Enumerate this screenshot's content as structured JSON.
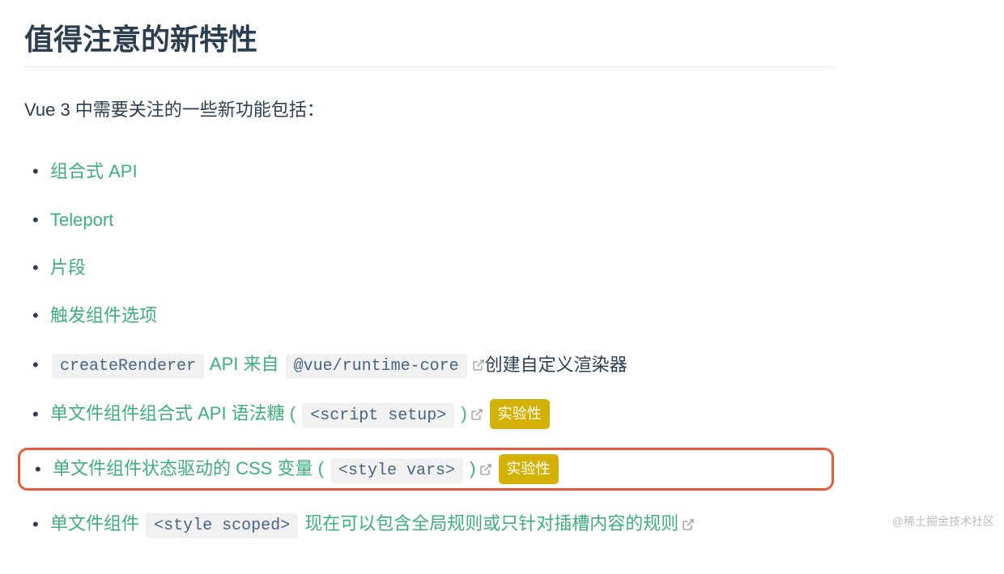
{
  "heading": "值得注意的新特性",
  "intro": "Vue 3 中需要关注的一些新功能包括：",
  "items": {
    "item0": {
      "label": "组合式 API"
    },
    "item1": {
      "label": "Teleport"
    },
    "item2": {
      "label": "片段"
    },
    "item3": {
      "label": "触发组件选项"
    },
    "item4": {
      "code1": "createRenderer",
      "linkText": " API 来自 ",
      "code2": "@vue/runtime-core",
      "tail": " 创建自定义渲染器"
    },
    "item5": {
      "prefix": "单文件组件组合式 API 语法糖 ( ",
      "code": "<script setup>",
      "suffix": " )",
      "badge": "实验性"
    },
    "item6": {
      "prefix": "单文件组件状态驱动的 CSS 变量 ( ",
      "code": "<style vars>",
      "suffix": " )",
      "badge": "实验性"
    },
    "item7": {
      "prefix": "单文件组件 ",
      "code": "<style scoped>",
      "suffix": " 现在可以包含全局规则或只针对插槽内容的规则"
    }
  },
  "watermark": "@稀土掘金技术社区"
}
